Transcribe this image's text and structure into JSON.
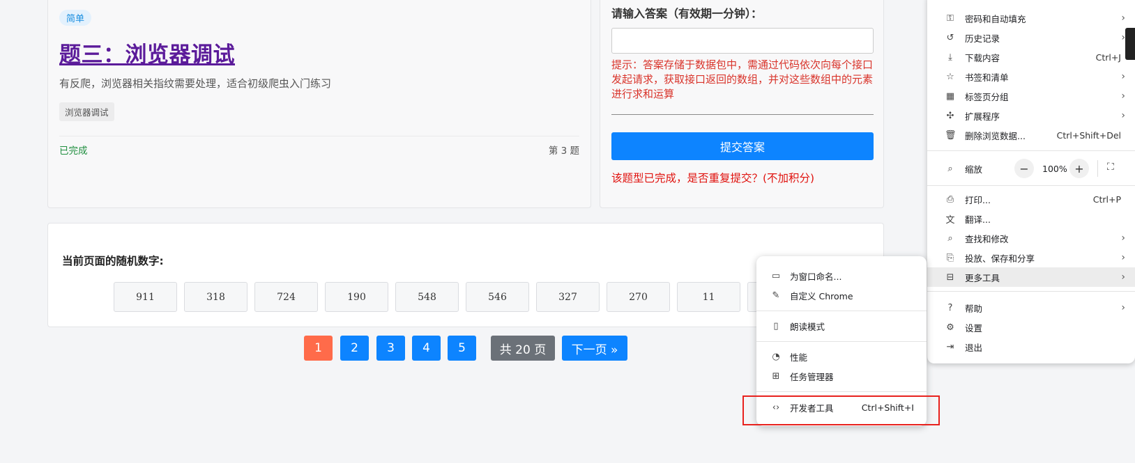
{
  "question": {
    "difficulty": "简单",
    "title": "题三：浏览器调试",
    "description": "有反爬，浏览器相关指纹需要处理，适合初级爬虫入门练习",
    "tag": "浏览器调试",
    "status": "已完成",
    "number": "第 3 题"
  },
  "answer": {
    "label": "请输入答案（有效期一分钟）：",
    "input_value": "",
    "hint": "提示：答案存储于数据包中，需通过代码依次向每个接口发起请求，获取接口返回的数组，并对这些数组中的元素进行求和运算",
    "submit_label": "提交答案",
    "note": "该题型已完成，是否重复提交？(不加积分)"
  },
  "random": {
    "title": "当前页面的随机数字:",
    "numbers": [
      "911",
      "318",
      "724",
      "190",
      "548",
      "546",
      "327",
      "270",
      "11",
      ""
    ]
  },
  "pagination": {
    "pages": [
      "1",
      "2",
      "3",
      "4",
      "5"
    ],
    "total": "共 20 页",
    "next": "下一页 »",
    "active_color": "#ff6b4a",
    "page_color": "#0d84ff",
    "total_color": "#6b7178"
  },
  "chrome_menu": {
    "items": [
      {
        "icon": "key-icon",
        "glyph": "⚿",
        "label": "密码和自动填充",
        "shortcut": "",
        "arrow": "›"
      },
      {
        "icon": "history-icon",
        "glyph": "↺",
        "label": "历史记录",
        "shortcut": "",
        "arrow": "›"
      },
      {
        "icon": "download-icon",
        "glyph": "⤓",
        "label": "下载内容",
        "shortcut": "Ctrl+J",
        "arrow": ""
      },
      {
        "icon": "star-icon",
        "glyph": "☆",
        "label": "书签和清单",
        "shortcut": "",
        "arrow": "›"
      },
      {
        "icon": "tab-groups-icon",
        "glyph": "▦",
        "label": "标签页分组",
        "shortcut": "",
        "arrow": "›"
      },
      {
        "icon": "extension-icon",
        "glyph": "✣",
        "label": "扩展程序",
        "shortcut": "",
        "arrow": "›"
      },
      {
        "icon": "trash-icon",
        "glyph": "🗑",
        "label": "删除浏览数据...",
        "shortcut": "Ctrl+Shift+Del",
        "arrow": ""
      }
    ],
    "zoom": {
      "label": "缩放",
      "minus": "−",
      "value": "100%",
      "plus": "+"
    },
    "items2": [
      {
        "icon": "print-icon",
        "glyph": "⎙",
        "label": "打印...",
        "shortcut": "Ctrl+P",
        "arrow": ""
      },
      {
        "icon": "translate-icon",
        "glyph": "文",
        "label": "翻译...",
        "shortcut": "",
        "arrow": ""
      },
      {
        "icon": "find-icon",
        "glyph": "⌕",
        "label": "查找和修改",
        "shortcut": "",
        "arrow": "›"
      },
      {
        "icon": "cast-icon",
        "glyph": "⎘",
        "label": "投放、保存和分享",
        "shortcut": "",
        "arrow": "›"
      },
      {
        "icon": "toolbox-icon",
        "glyph": "⊟",
        "label": "更多工具",
        "shortcut": "",
        "arrow": "›"
      }
    ],
    "items3": [
      {
        "icon": "help-icon",
        "glyph": "?",
        "label": "帮助",
        "shortcut": "",
        "arrow": "›"
      },
      {
        "icon": "settings-icon",
        "glyph": "⚙",
        "label": "设置",
        "shortcut": "",
        "arrow": ""
      },
      {
        "icon": "exit-icon",
        "glyph": "⇥",
        "label": "退出",
        "shortcut": "",
        "arrow": ""
      }
    ]
  },
  "more_tools": {
    "groups": [
      [
        {
          "icon": "window-icon",
          "glyph": "▭",
          "label": "为窗口命名...",
          "shortcut": ""
        },
        {
          "icon": "pen-icon",
          "glyph": "✎",
          "label": "自定义 Chrome",
          "shortcut": ""
        }
      ],
      [
        {
          "icon": "reading-mode-icon",
          "glyph": "▯",
          "label": "朗读模式",
          "shortcut": ""
        }
      ],
      [
        {
          "icon": "performance-icon",
          "glyph": "◔",
          "label": "性能",
          "shortcut": ""
        },
        {
          "icon": "task-manager-icon",
          "glyph": "⊞",
          "label": "任务管理器",
          "shortcut": ""
        }
      ],
      [
        {
          "icon": "code-icon",
          "glyph": "‹›",
          "label": "开发者工具",
          "shortcut": "Ctrl+Shift+I"
        }
      ]
    ]
  }
}
